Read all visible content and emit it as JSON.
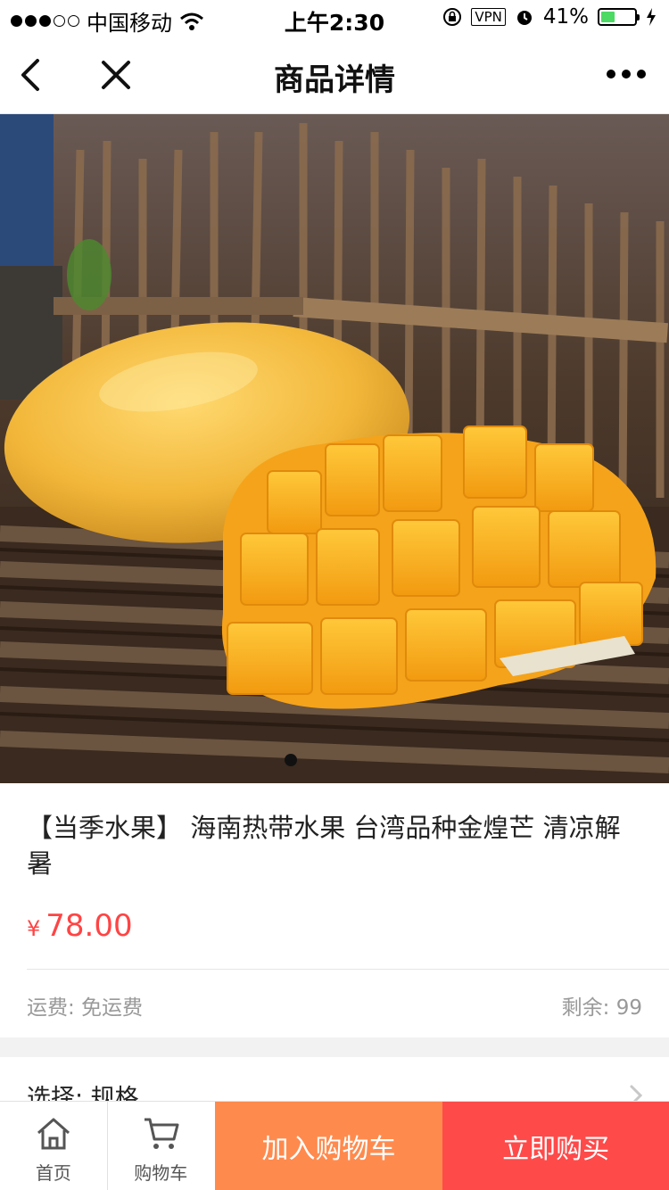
{
  "status_bar": {
    "carrier": "中国移动",
    "time": "上午2:30",
    "vpn": "VPN",
    "battery": "41%",
    "battery_level": 0.41
  },
  "nav": {
    "title": "商品详情",
    "back_icon": "chevron-left-icon",
    "close_icon": "close-icon",
    "more_icon": "more-dots-icon"
  },
  "gallery": {
    "image": "mango product photo",
    "page_count": 1,
    "current_page": 1
  },
  "product": {
    "title": "【当季水果】 海南热带水果 台湾品种金煌芒 清凉解暑",
    "currency": "¥",
    "price": "78.00",
    "shipping": "运费: 免运费",
    "stock": "剩余: 99"
  },
  "spec": {
    "label": "选择: 规格"
  },
  "actions": {
    "home_label": "首页",
    "cart_label": "购物车",
    "add_to_cart": "加入购物车",
    "buy_now": "立即购买"
  },
  "colors": {
    "price": "#ff4444",
    "add_to_cart_bg": "#ff8a4d",
    "buy_now_bg": "#ff4a4a"
  }
}
